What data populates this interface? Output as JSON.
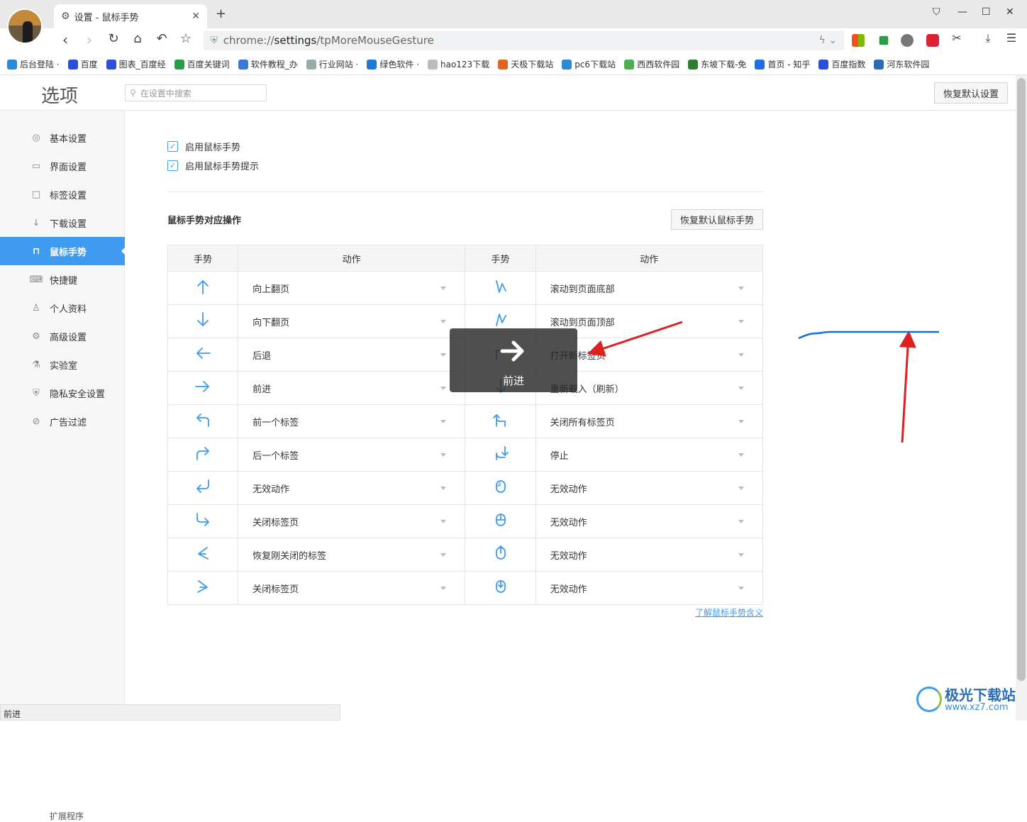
{
  "browser": {
    "tab_title": "设置 - 鼠标手势",
    "url_prefix": "chrome://",
    "url_main": "settings",
    "url_rest": "/tpMoreMouseGesture"
  },
  "bookmarks": [
    {
      "label": "后台登陆 ·",
      "color": "#2a8ad6"
    },
    {
      "label": "百度",
      "color": "#2b4fd6"
    },
    {
      "label": "图表_百度经",
      "color": "#2b4fd6"
    },
    {
      "label": "百度关键词",
      "color": "#2a9d4a"
    },
    {
      "label": "软件教程_办",
      "color": "#3a7bd6"
    },
    {
      "label": "行业网站 ·",
      "color": "#9aa"
    },
    {
      "label": "绿色软件 ·",
      "color": "#1f7ad6"
    },
    {
      "label": "hao123下载",
      "color": "#bbb"
    },
    {
      "label": "天极下载站",
      "color": "#e0641e"
    },
    {
      "label": "pc6下载站",
      "color": "#2a8ad6"
    },
    {
      "label": "西西软件园",
      "color": "#4caf50"
    },
    {
      "label": "东坡下载-免",
      "color": "#2e7d32"
    },
    {
      "label": "首页 - 知乎",
      "color": "#1e6fe0"
    },
    {
      "label": "百度指数",
      "color": "#2b4fd6"
    },
    {
      "label": "河东软件园",
      "color": "#2a6db6"
    }
  ],
  "header": {
    "title": "选项",
    "search_placeholder": "在设置中搜索",
    "restore_all": "恢复默认设置"
  },
  "sidebar": {
    "items": [
      {
        "label": "基本设置",
        "icon": "◎"
      },
      {
        "label": "界面设置",
        "icon": "▭"
      },
      {
        "label": "标签设置",
        "icon": "□"
      },
      {
        "label": "下载设置",
        "icon": "↓"
      },
      {
        "label": "鼠标手势",
        "icon": "⊓"
      },
      {
        "label": "快捷键",
        "icon": "⌨"
      },
      {
        "label": "个人资料",
        "icon": "♙"
      },
      {
        "label": "高级设置",
        "icon": "⚙"
      },
      {
        "label": "实验室",
        "icon": "⚗"
      },
      {
        "label": "隐私安全设置",
        "icon": "⛨"
      },
      {
        "label": "广告过滤",
        "icon": "⊘"
      }
    ],
    "bottom_item": "扩展程序"
  },
  "content": {
    "enable_gesture": "启用鼠标手势",
    "enable_gesture_tip": "启用鼠标手势提示",
    "section_title": "鼠标手势对应操作",
    "restore_gesture": "恢复默认鼠标手势",
    "col_gesture": "手势",
    "col_action": "动作",
    "learn_more": "了解鼠标手势含义"
  },
  "gesture_rows": [
    {
      "left": "向上翻页",
      "right": "滚动到页面底部"
    },
    {
      "left": "向下翻页",
      "right": "滚动到页面顶部"
    },
    {
      "left": "后退",
      "right": "打开新标签页"
    },
    {
      "left": "前进",
      "right": "重新载入（刷新）"
    },
    {
      "left": "前一个标签",
      "right": "关闭所有标签页"
    },
    {
      "left": "后一个标签",
      "right": "停止"
    },
    {
      "left": "无效动作",
      "right": "无效动作"
    },
    {
      "left": "关闭标签页",
      "right": "无效动作"
    },
    {
      "left": "恢复刚关闭的标签",
      "right": "无效动作"
    },
    {
      "left": "关闭标签页",
      "right": "无效动作"
    }
  ],
  "osd": {
    "label": "前进"
  },
  "status_text": "前进",
  "watermark": {
    "title": "极光下载站",
    "url": "www.xz7.com"
  },
  "colors": {
    "accent": "#3e9bf0",
    "annotation": "#e02020",
    "gesture_trail": "#1a6fd6"
  }
}
